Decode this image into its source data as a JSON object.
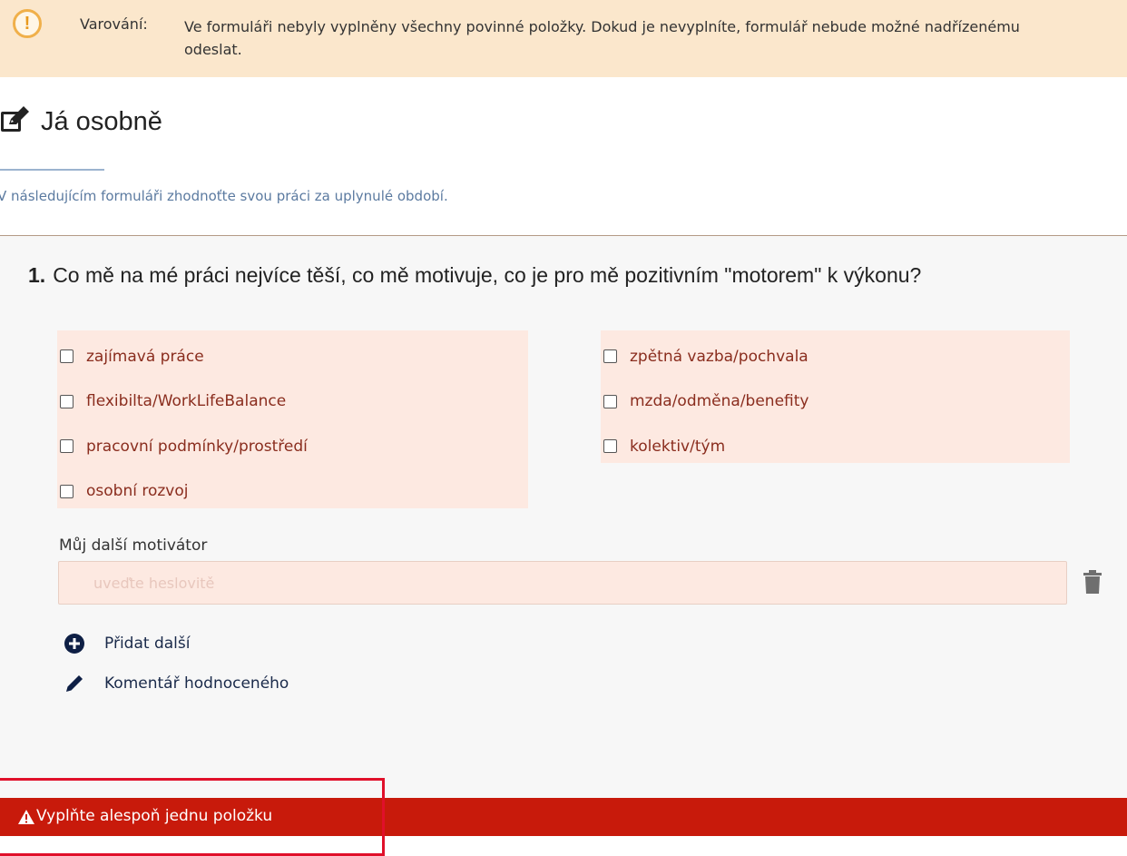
{
  "warning": {
    "icon": "exclamation-icon",
    "label": "Varování:",
    "text": "Ve formuláři nebyly vyplněny všechny povinné položky. Dokud je nevyplníte, formulář nebude možné nadřízenému odeslat."
  },
  "section": {
    "icon": "edit-icon",
    "title": "Já osobně",
    "subtitle": "V následujícím formuláři zhodnoťte svou práci za uplynulé období."
  },
  "question": {
    "number": "1.",
    "text": "Co mě na mé práci nejvíce těší, co mě motivuje, co je pro mě pozitivním \"motorem\" k výkonu?",
    "options_left": [
      {
        "label": "zajímavá práce",
        "checked": false
      },
      {
        "label": "flexibilta/WorkLifeBalance",
        "checked": false
      },
      {
        "label": "pracovní podmínky/prostředí",
        "checked": false
      },
      {
        "label": "osobní rozvoj",
        "checked": false
      }
    ],
    "options_right": [
      {
        "label": "zpětná vazba/pochvala",
        "checked": false
      },
      {
        "label": "mzda/odměna/benefity",
        "checked": false
      },
      {
        "label": "kolektiv/tým",
        "checked": false
      }
    ],
    "other": {
      "label": "Můj další motivátor",
      "value": "",
      "placeholder": "uveďte heslovitě"
    },
    "actions": {
      "add_label": "Přidat další",
      "comment_label": "Komentář hodnoceného"
    }
  },
  "error": {
    "text": "Vyplňte alespoň jednu položku"
  },
  "colors": {
    "warning_bg": "#fbe7cc",
    "option_bg": "#fde9e1",
    "option_text": "#8a2d1e",
    "error_bg": "#c81a0b",
    "highlight": "#e0102a"
  }
}
